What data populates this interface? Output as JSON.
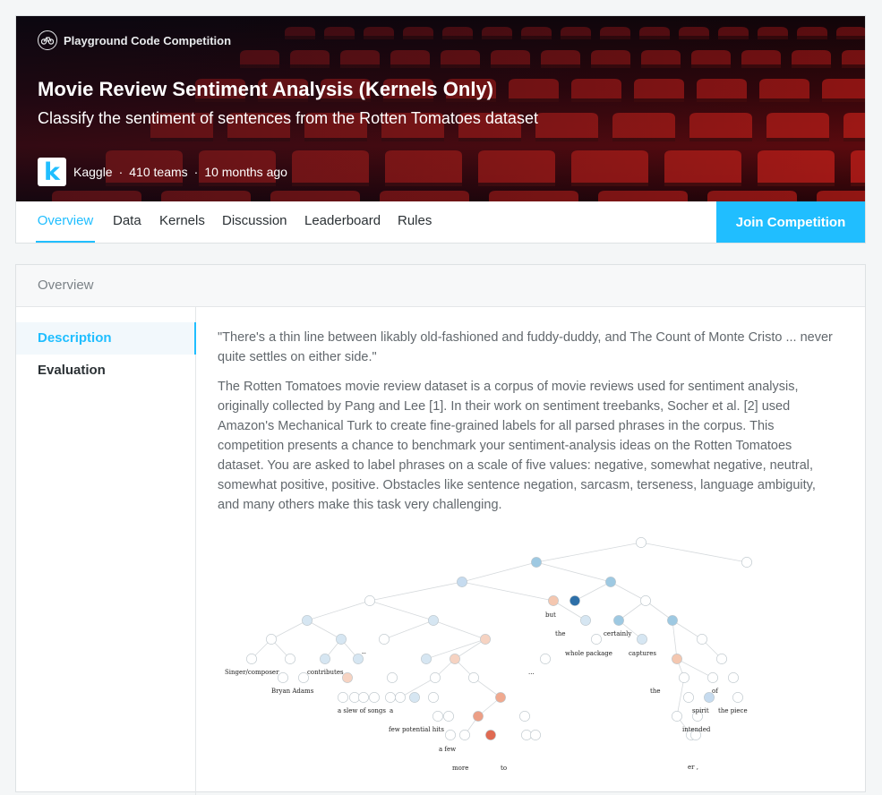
{
  "competition": {
    "type_label": "Playground Code Competition",
    "title": "Movie Review Sentiment Analysis (Kernels Only)",
    "subtitle": "Classify the sentiment of sentences from the Rotten Tomatoes dataset",
    "host": "Kaggle",
    "logo_letter": "k",
    "teams": "410 teams",
    "time_ago": "10 months ago"
  },
  "tabs": [
    "Overview",
    "Data",
    "Kernels",
    "Discussion",
    "Leaderboard",
    "Rules"
  ],
  "active_tab": "Overview",
  "join_button": "Join Competition",
  "overview": {
    "header": "Overview",
    "sidebar": [
      "Description",
      "Evaluation"
    ],
    "active_sidebar": "Description",
    "quote": "\"There's a thin line between likably old-fashioned and fuddy-duddy, and The Count of Monte Cristo ... never quite settles on either side.\"",
    "body": "The Rotten Tomatoes movie review dataset is a corpus of movie reviews used for sentiment analysis, originally collected by Pang and Lee [1]. In their work on sentiment treebanks, Socher et al. [2] used Amazon's Mechanical Turk to create fine-grained labels for all parsed phrases in the corpus. This competition presents a chance to benchmark your sentiment-analysis ideas on the Rotten Tomatoes dataset. You are asked to label phrases on a scale of five values: negative, somewhat negative, neutral, somewhat positive, positive. Obstacles like sentence negation, sarcasm, terseness, language ambiguity, and many others make this task very challenging."
  },
  "tree_words": [
    "Singer/composer",
    "Bryan Adams",
    "contributes",
    "a slew of songs",
    "a",
    "few potential hits",
    "a few",
    "more",
    "to",
    "but",
    "the",
    "whole package",
    "certainly",
    "captures",
    "the",
    "intended",
    "er ,",
    "spirit",
    "of",
    "the piece",
    "--",
    "..."
  ],
  "colors": {
    "accent": "#20beff",
    "negative": "#d6604d",
    "positive": "#4393c3"
  }
}
